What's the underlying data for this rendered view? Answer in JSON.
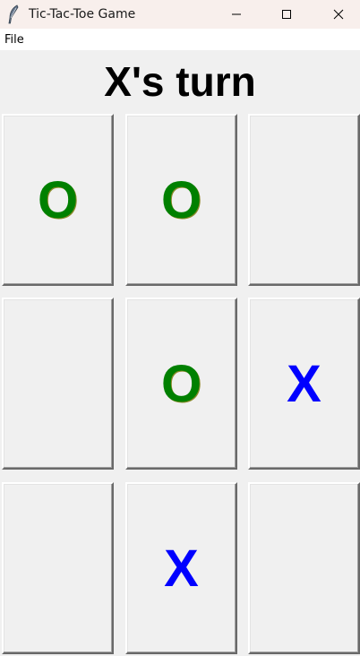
{
  "window": {
    "title": "Tic-Tac-Toe Game",
    "icon": "feather-icon",
    "controls": [
      "minimize-icon",
      "maximize-icon",
      "close-icon"
    ]
  },
  "menu": {
    "file_label": "File"
  },
  "status": {
    "text": "X's turn"
  },
  "board": {
    "cells": [
      {
        "mark": "O"
      },
      {
        "mark": "O"
      },
      {
        "mark": ""
      },
      {
        "mark": ""
      },
      {
        "mark": "O"
      },
      {
        "mark": "X"
      },
      {
        "mark": ""
      },
      {
        "mark": "X"
      },
      {
        "mark": ""
      }
    ]
  },
  "colors": {
    "o_mark": "#008000",
    "x_mark": "#0000ff",
    "background": "#f0f0f0",
    "titlebar": "#f8efec"
  }
}
